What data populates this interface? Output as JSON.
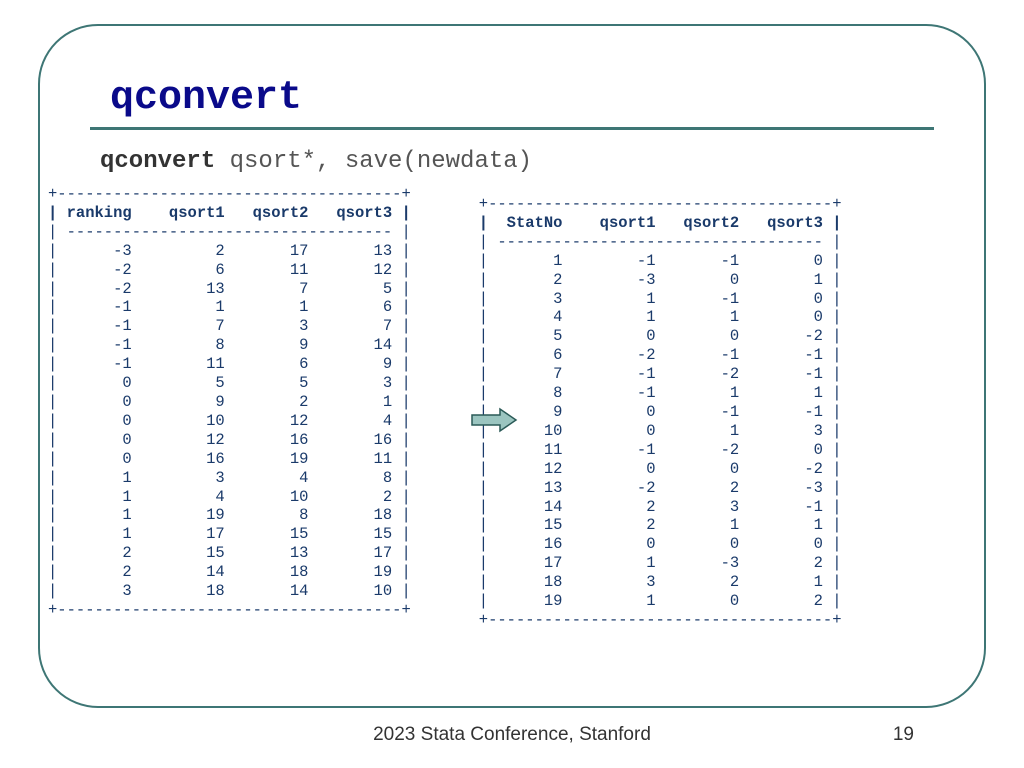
{
  "title": "qconvert",
  "command": {
    "keyword": "qconvert",
    "rest": " qsort*, save(newdata)"
  },
  "left_table": {
    "headers": [
      "ranking",
      "qsort1",
      "qsort2",
      "qsort3"
    ],
    "rows": [
      [
        -3,
        2,
        17,
        13
      ],
      [
        -2,
        6,
        11,
        12
      ],
      [
        -2,
        13,
        7,
        5
      ],
      [
        -1,
        1,
        1,
        6
      ],
      [
        -1,
        7,
        3,
        7
      ],
      [
        -1,
        8,
        9,
        14
      ],
      [
        -1,
        11,
        6,
        9
      ],
      [
        0,
        5,
        5,
        3
      ],
      [
        0,
        9,
        2,
        1
      ],
      [
        0,
        10,
        12,
        4
      ],
      [
        0,
        12,
        16,
        16
      ],
      [
        0,
        16,
        19,
        11
      ],
      [
        1,
        3,
        4,
        8
      ],
      [
        1,
        4,
        10,
        2
      ],
      [
        1,
        19,
        8,
        18
      ],
      [
        1,
        17,
        15,
        15
      ],
      [
        2,
        15,
        13,
        17
      ],
      [
        2,
        14,
        18,
        19
      ],
      [
        3,
        18,
        14,
        10
      ]
    ]
  },
  "right_table": {
    "headers": [
      "StatNo",
      "qsort1",
      "qsort2",
      "qsort3"
    ],
    "rows": [
      [
        1,
        -1,
        -1,
        0
      ],
      [
        2,
        -3,
        0,
        1
      ],
      [
        3,
        1,
        -1,
        0
      ],
      [
        4,
        1,
        1,
        0
      ],
      [
        5,
        0,
        0,
        -2
      ],
      [
        6,
        -2,
        -1,
        -1
      ],
      [
        7,
        -1,
        -2,
        -1
      ],
      [
        8,
        -1,
        1,
        1
      ],
      [
        9,
        0,
        -1,
        -1
      ],
      [
        10,
        0,
        1,
        3
      ],
      [
        11,
        -1,
        -2,
        0
      ],
      [
        12,
        0,
        0,
        -2
      ],
      [
        13,
        -2,
        2,
        -3
      ],
      [
        14,
        2,
        3,
        -1
      ],
      [
        15,
        2,
        1,
        1
      ],
      [
        16,
        0,
        0,
        0
      ],
      [
        17,
        1,
        -3,
        2
      ],
      [
        18,
        3,
        2,
        1
      ],
      [
        19,
        1,
        0,
        2
      ]
    ]
  },
  "footer": "2023 Stata Conference, Stanford",
  "page": "19"
}
